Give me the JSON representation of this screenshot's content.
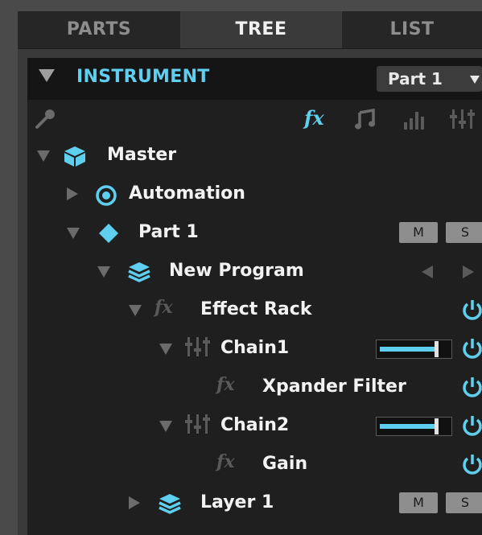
{
  "tabs": {
    "parts": "PARTS",
    "tree": "TREE",
    "list": "LIST",
    "active": "TREE"
  },
  "header": {
    "title": "INSTRUMENT",
    "part_select": "Part 1"
  },
  "toolbar": {
    "icons": [
      "wrench-icon",
      "fx-icon",
      "note-icon",
      "bars-icon",
      "mixer-icon"
    ],
    "fx_label": "fx"
  },
  "tree": {
    "master": {
      "label": "Master",
      "icon": "cube-icon",
      "expanded": true
    },
    "automation": {
      "label": "Automation",
      "icon": "target-icon",
      "expanded": false
    },
    "part1": {
      "label": "Part 1",
      "icon": "diamond-icon",
      "expanded": true,
      "mute": "M",
      "solo": "S"
    },
    "new_program": {
      "label": "New Program",
      "icon": "layers-icon",
      "expanded": true
    },
    "effect_rack": {
      "label": "Effect Rack",
      "icon_text": "fx",
      "expanded": true,
      "enabled": true
    },
    "chain1": {
      "label": "Chain1",
      "icon": "mixer-icon",
      "expanded": true,
      "level": 0.8,
      "enabled": true
    },
    "xpander": {
      "label": "Xpander Filter",
      "icon_text": "fx",
      "enabled": true
    },
    "chain2": {
      "label": "Chain2",
      "icon": "mixer-icon",
      "expanded": true,
      "level": 0.8,
      "enabled": true
    },
    "gain": {
      "label": "Gain",
      "icon_text": "fx",
      "enabled": true
    },
    "layer1": {
      "label": "Layer 1",
      "icon": "layers-icon",
      "expanded": false,
      "mute": "M",
      "solo": "S"
    }
  },
  "colors": {
    "accent": "#5fcff0",
    "text": "#f2f2f2",
    "dim": "#6b6b6b",
    "button": "#8e8e8e"
  }
}
